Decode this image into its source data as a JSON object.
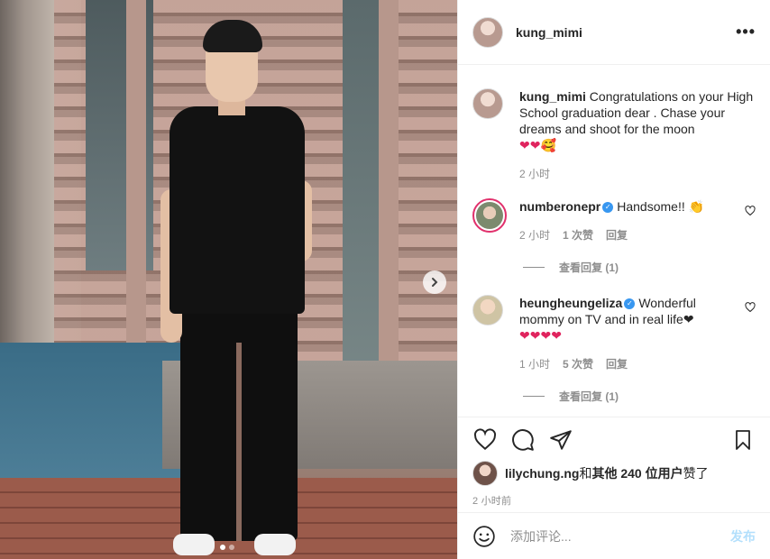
{
  "photo": {
    "next_icon": "chevron-right-icon",
    "carousel_count": 2,
    "carousel_active": 1
  },
  "header": {
    "username": "kung_mimi",
    "more_icon": "more-horizontal-icon",
    "more_label": "•••"
  },
  "comments": [
    {
      "user": "kung_mimi",
      "verified": false,
      "text": "Congratulations on your High School graduation dear . Chase your dreams and shoot for the moon",
      "emoji": "❤❤🥰",
      "time": "2 小时",
      "likes": "",
      "reply": ""
    },
    {
      "user": "numberonepr",
      "verified": true,
      "text": "Handsome!! 👏",
      "emoji": "👏",
      "time": "2 小时",
      "likes": "1 次赞",
      "reply": "回复",
      "view_replies": "查看回复 (1)"
    },
    {
      "user": "heungheungeliza",
      "verified": true,
      "text": "Wonderful mommy on TV and in real life❤",
      "emoji": "❤❤❤❤",
      "time": "1 小时",
      "likes": "5 次赞",
      "reply": "回复",
      "view_replies": "查看回复 (1)"
    }
  ],
  "actions": {
    "like_icon": "heart-outline-icon",
    "comment_icon": "comment-icon",
    "share_icon": "send-icon",
    "save_icon": "bookmark-icon"
  },
  "likes": {
    "user": "lilychung.ng",
    "and": " 和 ",
    "others": "其他 240 位用户",
    "suffix": " 赞了"
  },
  "posted_time": "2 小时前",
  "add_comment": {
    "placeholder": "添加评论...",
    "post_label": "发布",
    "emoji_icon": "smile-icon"
  }
}
